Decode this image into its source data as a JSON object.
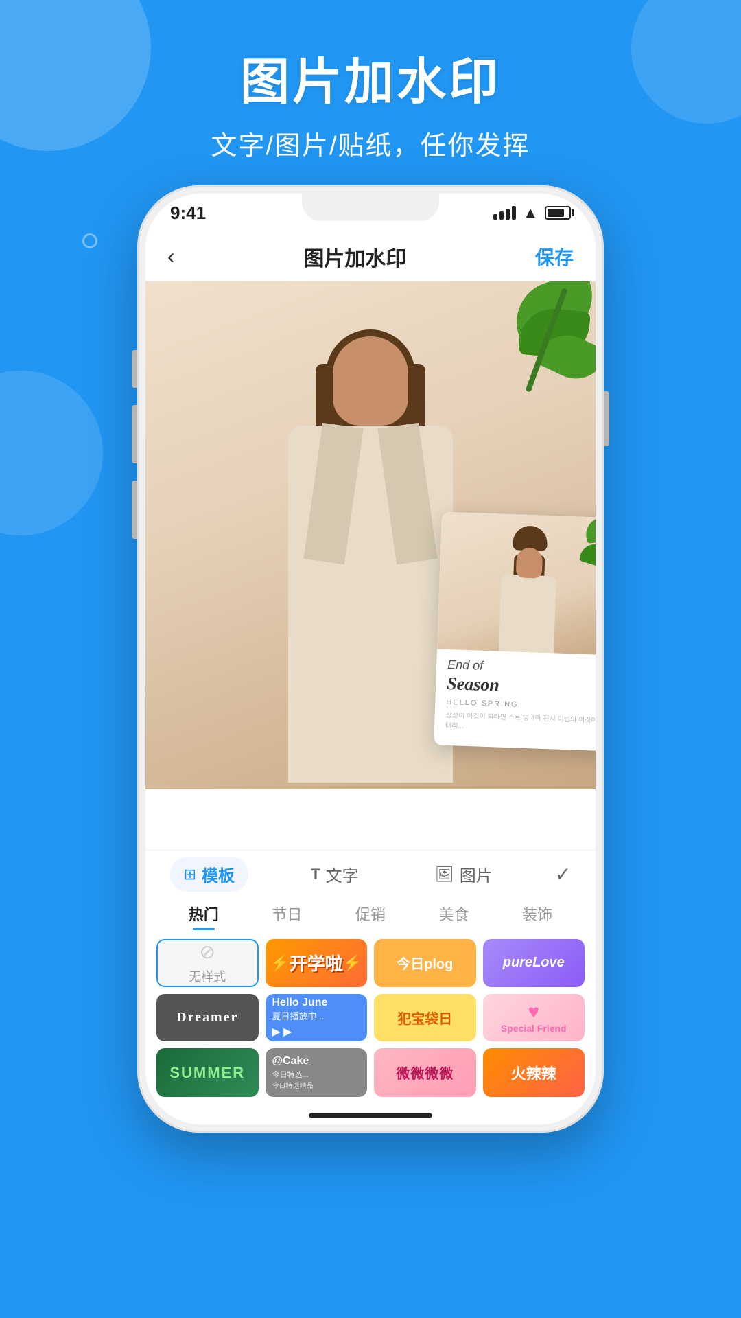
{
  "app": {
    "background_color": "#2196F3"
  },
  "header": {
    "main_title": "图片加水印",
    "sub_title": "文字/图片/贴纸，任你发挥"
  },
  "status_bar": {
    "time": "9:41"
  },
  "nav": {
    "back_label": "‹",
    "title": "图片加水印",
    "save_label": "保存"
  },
  "watermark_card": {
    "line1": "End of",
    "line2": "Season",
    "line3": "HELLO SPRING",
    "line4": "상상이 이것이 되라면 스트 넣 4마 전시 이번의 이것이 내려..."
  },
  "toolbar": {
    "tabs": [
      {
        "id": "template",
        "icon": "⊞",
        "label": "模板",
        "active": true
      },
      {
        "id": "text",
        "icon": "T",
        "label": "文字",
        "active": false
      },
      {
        "id": "image",
        "icon": "🖼",
        "label": "图片",
        "active": false
      }
    ],
    "check_icon": "✓"
  },
  "category_tabs": [
    {
      "id": "hot",
      "label": "热门",
      "active": true
    },
    {
      "id": "holiday",
      "label": "节日",
      "active": false
    },
    {
      "id": "promo",
      "label": "促销",
      "active": false
    },
    {
      "id": "food",
      "label": "美食",
      "active": false
    },
    {
      "id": "decor",
      "label": "装饰",
      "active": false
    }
  ],
  "templates": {
    "row1": [
      {
        "id": "none",
        "type": "none",
        "label": "无样式"
      },
      {
        "id": "kaixin",
        "type": "kaixin",
        "label": "开学啦"
      },
      {
        "id": "plog",
        "type": "plog",
        "label": "今日plog"
      },
      {
        "id": "love",
        "type": "love",
        "label": "pureLove"
      }
    ],
    "row2": [
      {
        "id": "dreamer",
        "type": "dreamer",
        "label": "Dreamer"
      },
      {
        "id": "hello",
        "type": "hello",
        "label": "Hello June",
        "sub": "夏日播放中..."
      },
      {
        "id": "yellow",
        "type": "yellow",
        "label": "犯宝袋日"
      },
      {
        "id": "special",
        "type": "special",
        "label": "Special Friend"
      }
    ],
    "row3": [
      {
        "id": "summer",
        "type": "summer",
        "label": "SUMMER"
      },
      {
        "id": "cake",
        "type": "cake",
        "label": "@Cake",
        "sub": "今日特选..."
      },
      {
        "id": "floral",
        "type": "floral",
        "label": "微微微微"
      },
      {
        "id": "spicy",
        "type": "spicy",
        "label": "火辣辣"
      }
    ]
  }
}
